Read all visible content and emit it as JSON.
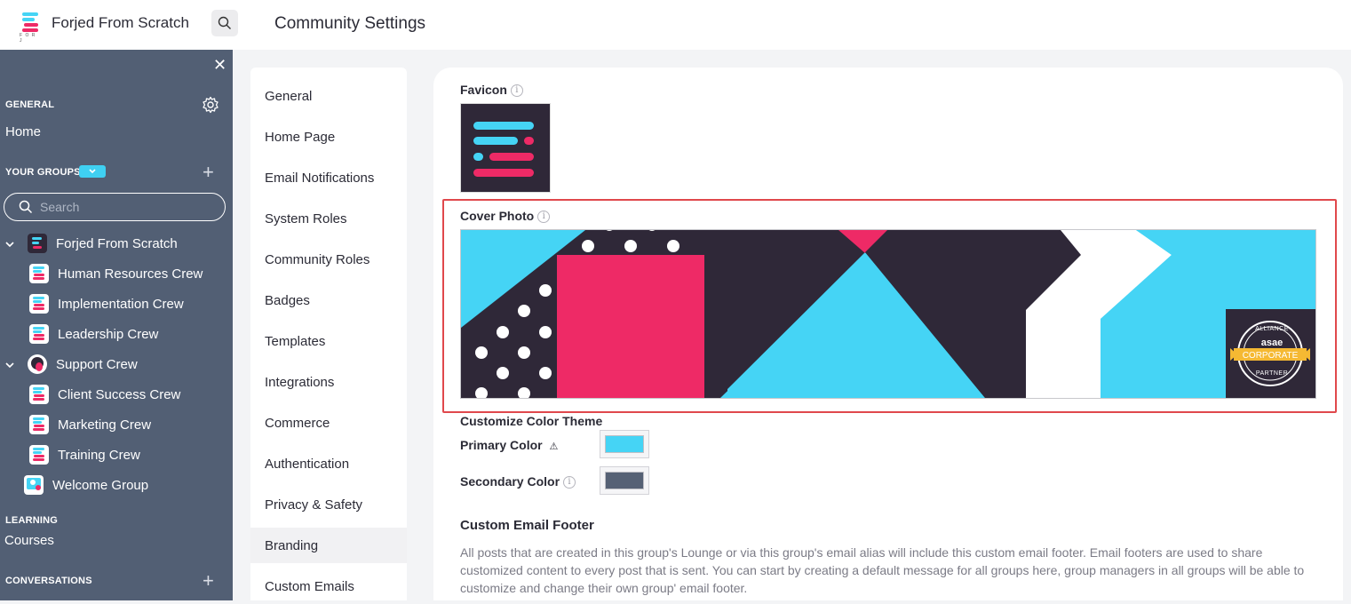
{
  "topbar": {
    "app_name": "Forjed From Scratch",
    "page_title": "Community Settings",
    "search_icon": "search-icon"
  },
  "sidebar": {
    "general_heading": "GENERAL",
    "home_link": "Home",
    "your_groups_heading": "YOUR GROUPS",
    "search_placeholder": "Search",
    "groups": [
      {
        "label": "Forjed From Scratch",
        "level": 0,
        "expanded": true
      },
      {
        "label": "Human Resources Crew",
        "level": 1
      },
      {
        "label": "Implementation Crew",
        "level": 1
      },
      {
        "label": "Leadership Crew",
        "level": 1
      },
      {
        "label": "Support Crew",
        "level": 0,
        "expanded": true
      },
      {
        "label": "Client Success Crew",
        "level": 1
      },
      {
        "label": "Marketing Crew",
        "level": 1
      },
      {
        "label": "Training Crew",
        "level": 1
      },
      {
        "label": "Welcome Group",
        "level": 0
      }
    ],
    "learning_heading": "LEARNING",
    "courses_link": "Courses",
    "conversations_heading": "CONVERSATIONS"
  },
  "settings_nav": {
    "items": [
      {
        "label": "General"
      },
      {
        "label": "Home Page"
      },
      {
        "label": "Email Notifications"
      },
      {
        "label": "System Roles"
      },
      {
        "label": "Community Roles"
      },
      {
        "label": "Badges"
      },
      {
        "label": "Templates"
      },
      {
        "label": "Integrations"
      },
      {
        "label": "Commerce"
      },
      {
        "label": "Authentication"
      },
      {
        "label": "Privacy & Safety"
      },
      {
        "label": "Branding",
        "active": true
      },
      {
        "label": "Custom Emails"
      }
    ]
  },
  "branding": {
    "favicon_label": "Favicon",
    "cover_photo_label": "Cover Photo",
    "cover_badge": {
      "line1": "ALLIANCE",
      "brand": "asae",
      "line2": "CORPORATE",
      "line3": "PARTNER"
    },
    "color_theme_heading": "Customize Color Theme",
    "primary_color_label": "Primary Color",
    "primary_color": "#45d4f5",
    "secondary_color_label": "Secondary Color",
    "secondary_color": "#566175",
    "email_footer_heading": "Custom Email Footer",
    "email_footer_text": "All posts that are created in this group's Lounge or via this group's email alias will include this custom email footer. Email footers are used to share customized content to every post that is sent. You can start by creating a default message for all groups here, group managers in all groups will be able to customize and change their own group' email footer."
  },
  "colors": {
    "brand_cyan": "#45d4f5",
    "brand_pink": "#ee2a66",
    "brand_dark": "#2f2838",
    "sidebar_bg": "#525f74",
    "highlight_red": "#e0484c"
  }
}
